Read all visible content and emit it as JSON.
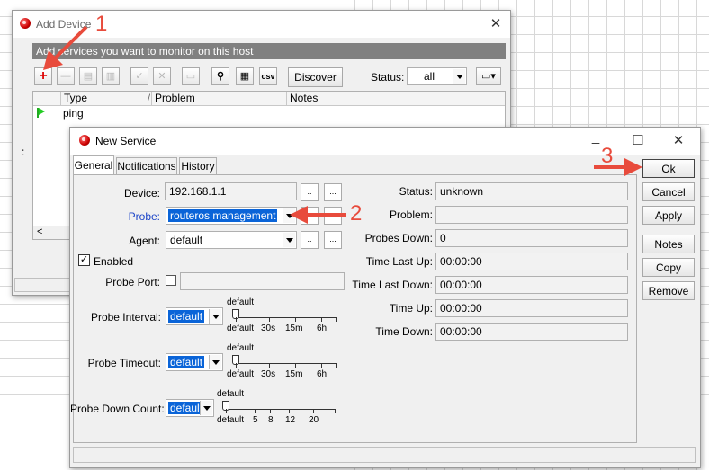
{
  "add_device": {
    "title": "Add Device",
    "subtitle": "Add services you want to monitor on this host",
    "toolbar": {
      "discover_label": "Discover",
      "status_label": "Status:",
      "status_value": "all",
      "csv_label": "csv"
    },
    "table": {
      "columns": [
        "Type",
        "Problem",
        "Notes"
      ],
      "rows": [
        {
          "type": "ping",
          "problem": "",
          "notes": ""
        }
      ]
    },
    "scroll_left_glyph": "<",
    "side_glyph": ":"
  },
  "new_service": {
    "title": "New Service",
    "tabs": [
      {
        "label": "General",
        "active": true
      },
      {
        "label": "Notifications",
        "active": false
      },
      {
        "label": "History",
        "active": false
      }
    ],
    "form": {
      "device_label": "Device:",
      "device_value": "192.168.1.1",
      "probe_label": "Probe:",
      "probe_value": "routeros management",
      "agent_label": "Agent:",
      "agent_value": "default",
      "enabled_label": "Enabled",
      "enabled_checked": true,
      "probe_port_label": "Probe Port:",
      "probe_interval_label": "Probe Interval:",
      "probe_interval_value": "default",
      "probe_interval_ticks": [
        "default",
        "30s",
        "15m",
        "6h"
      ],
      "probe_interval_marker": "default",
      "probe_timeout_label": "Probe Timeout:",
      "probe_timeout_value": "default",
      "probe_timeout_ticks": [
        "default",
        "30s",
        "15m",
        "6h"
      ],
      "probe_timeout_marker": "default",
      "probe_down_count_label": "Probe Down Count:",
      "probe_down_count_value": "default",
      "probe_down_count_ticks": [
        "default",
        "5",
        "8",
        "12",
        "20"
      ],
      "probe_down_count_marker": "default",
      "ellipsis_small": "..",
      "ellipsis": "..."
    },
    "status": {
      "status_label": "Status:",
      "status_value": "unknown",
      "problem_label": "Problem:",
      "problem_value": "",
      "probes_down_label": "Probes Down:",
      "probes_down_value": "0",
      "time_last_up_label": "Time Last Up:",
      "time_last_up_value": "00:00:00",
      "time_last_down_label": "Time Last Down:",
      "time_last_down_value": "00:00:00",
      "time_up_label": "Time Up:",
      "time_up_value": "00:00:00",
      "time_down_label": "Time Down:",
      "time_down_value": "00:00:00"
    },
    "buttons": {
      "ok": "Ok",
      "cancel": "Cancel",
      "apply": "Apply",
      "notes": "Notes",
      "copy": "Copy",
      "remove": "Remove"
    }
  },
  "annotations": {
    "step1": "1",
    "step2": "2",
    "step3": "3"
  },
  "colors": {
    "annotation_red": "#e84b3c",
    "selection_blue": "#0a64d8",
    "subtitle_bar": "#808080"
  }
}
